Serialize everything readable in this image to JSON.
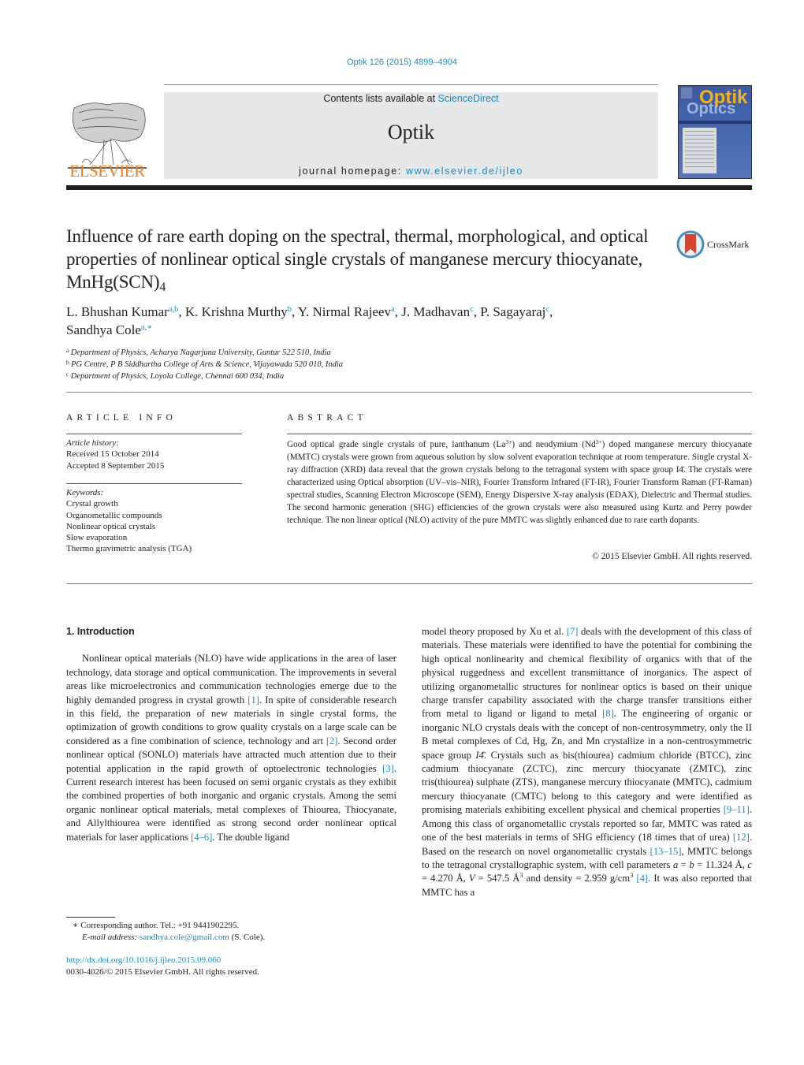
{
  "header": {
    "citation": "Optik 126 (2015) 4899–4904",
    "contents_prefix": "Contents lists available at ",
    "contents_link": "ScienceDirect",
    "journal_name": "Optik",
    "homepage_prefix": "journal homepage: ",
    "homepage_link": "www.elsevier.de/ijleo",
    "publisher_logo_text": "ELSEVIER",
    "cover_title": "Optik",
    "cover_subtitle": "Optics",
    "crossmark_label": "CrossMark"
  },
  "article": {
    "title_main": "Influence of rare earth doping on the spectral, thermal, morphological, and optical properties of nonlinear optical single crystals of manganese mercury thiocyanate, MnHg(SCN)",
    "title_sub": "4",
    "authors": [
      {
        "name": "L. Bhushan Kumar",
        "aff": "a,b",
        "sep": ", "
      },
      {
        "name": "K. Krishna Murthy",
        "aff": "b",
        "sep": ", "
      },
      {
        "name": "Y. Nirmal Rajeev",
        "aff": "a",
        "sep": ", "
      },
      {
        "name": "J. Madhavan",
        "aff": "c",
        "sep": ", "
      },
      {
        "name": "P. Sagayaraj",
        "aff": "c",
        "sep": ","
      },
      {
        "name": "Sandhya Cole",
        "aff": "a,∗",
        "sep": ""
      }
    ],
    "affiliations": [
      {
        "key": "a",
        "text": "Department of Physics, Acharya Nagarjuna University, Guntur 522 510, India"
      },
      {
        "key": "b",
        "text": "PG Centre, P B Siddhartha College of Arts & Science, Vijayawada 520 010, India"
      },
      {
        "key": "c",
        "text": "Department of Physics, Loyola College, Chennai 600 034, India"
      }
    ]
  },
  "article_info": {
    "heading": "ARTICLE INFO",
    "history_label": "Article history:",
    "received": "Received 15 October 2014",
    "accepted": "Accepted 8 September 2015",
    "keywords_label": "Keywords:",
    "keywords": [
      "Crystal growth",
      "Organometallic compounds",
      "Nonlinear optical crystals",
      "Slow evaporation",
      "Thermo gravimetric analysis (TGA)"
    ]
  },
  "abstract": {
    "heading": "ABSTRACT",
    "p1": "Good optical grade single crystals of pure, lanthanum (La",
    "sup1": "3+",
    "p2": ") and neodymium (Nd",
    "sup2": "3+",
    "p3": ") doped manganese mercury thiocyanate (MMTC) crystals were grown from aqueous solution by slow solvent evaporation technique at room temperature. Single crystal X-ray diffraction (XRD) data reveal that the grown crystals belong to the tetragonal system with space group I4̄. The crystals were characterized using Optical absorption (UV–vis–NIR), Fourier Transform Infrared (FT-IR), Fourier Transform Raman (FT-Raman) spectral studies, Scanning Electron Microscope (SEM), Energy Dispersive X-ray analysis (EDAX), Dielectric and Thermal studies. The second harmonic generation (SHG) efficiencies of the grown crystals were also measured using Kurtz and Perry powder technique. The non linear optical (NLO) activity of the pure MMTC was slightly enhanced due to rare earth dopants.",
    "copyright": "© 2015 Elsevier GmbH. All rights reserved."
  },
  "body": {
    "section_title": "1.  Introduction",
    "left": [
      {
        "t": "Nonlinear optical materials (NLO) have wide applications in the area of laser technology, data storage and optical communication. The improvements in several areas like microelectronics and communication technologies emerge due to the highly demanded progress in crystal growth "
      },
      {
        "ref": "[1]"
      },
      {
        "t": ". In spite of considerable research in this field, the preparation of new materials in single crystal forms, the optimization of growth conditions to grow quality crystals on a large scale can be considered as a fine combination of science, technology and art "
      },
      {
        "ref": "[2]"
      },
      {
        "t": ". Second order nonlinear optical (SONLO) materials have attracted much attention due to their potential application in the rapid growth of optoelectronic technologies "
      },
      {
        "ref": "[3]"
      },
      {
        "t": ". Current research interest has been focused on semi organic crystals as they exhibit the combined properties of both inorganic and organic crystals. Among the semi organic nonlinear optical materials, metal complexes of Thiourea, Thiocyanate, and Allylthiourea were identified as strong second order nonlinear optical materials for laser applications "
      },
      {
        "ref": "[4–6]"
      },
      {
        "t": ". The double ligand"
      }
    ],
    "right": [
      {
        "t": "model theory proposed by Xu et al. "
      },
      {
        "ref": "[7]"
      },
      {
        "t": " deals with the development of this class of materials. These materials were identified to have the potential for combining the high optical nonlinearity and chemical flexibility of organics with that of the physical ruggedness and excellent transmittance of inorganics. The aspect of utilizing organometallic structures for nonlinear optics is based on their unique charge transfer capability associated with the charge transfer transitions either from metal to ligand or ligand to metal "
      },
      {
        "ref": "[8]"
      },
      {
        "t": ". The engineering of organic or inorganic NLO crystals deals with the concept of non-centrosymmetry, only the II B metal complexes of Cd, Hg, Zn, and Mn crystallize in a non-centrosymmetric space group "
      },
      {
        "it": "I4̄"
      },
      {
        "t": ". Crystals such as bis(thiourea) cadmium chloride (BTCC), zinc cadmium thiocyanate (ZCTC), zinc mercury thiocyanate (ZMTC), zinc tris(thiourea) sulphate (ZTS), manganese mercury thiocyanate (MMTC), cadmium mercury thiocyanate (CMTC) belong to this category and were identified as promising materials exhibiting excellent physical and chemical properties "
      },
      {
        "ref": "[9–11]"
      },
      {
        "t": ". Among this class of organometallic crystals reported so far, MMTC was rated as one of the best materials in terms of SHG efficiency (18 times that of urea) "
      },
      {
        "ref": "[12]"
      },
      {
        "t": ". Based on the research on novel organometallic crystals "
      },
      {
        "ref": "[13–15]"
      },
      {
        "t": ", MMTC belongs to the tetragonal crystallographic system, with cell parameters "
      },
      {
        "it": "a"
      },
      {
        "t": " = "
      },
      {
        "it": "b"
      },
      {
        "t": " = 11.324 Å, "
      },
      {
        "it": "c"
      },
      {
        "t": " = 4.270 Å, "
      },
      {
        "it": "V"
      },
      {
        "t": " = 547.5 Å"
      },
      {
        "sup": "3"
      },
      {
        "t": " and density = 2.959 g/cm"
      },
      {
        "sup": "3"
      },
      {
        "t": " "
      },
      {
        "ref": "[4]"
      },
      {
        "t": ". It was also reported that MMTC has a"
      }
    ]
  },
  "footnote": {
    "marker": "∗",
    "corresponding": " Corresponding author. Tel.: +91 9441902295.",
    "email_label": "E-mail address:",
    "email": "sandhya.cole@gmail.com",
    "email_suffix": " (S. Cole).",
    "doi": "http://dx.doi.org/10.1016/j.ijleo.2015.09.060",
    "issn_line": "0030-4026/© 2015 Elsevier GmbH. All rights reserved."
  },
  "colors": {
    "link": "#1c8bbf",
    "elsevier_orange": "#f07c1f",
    "journal_box_bg": "#e6e7e8"
  }
}
